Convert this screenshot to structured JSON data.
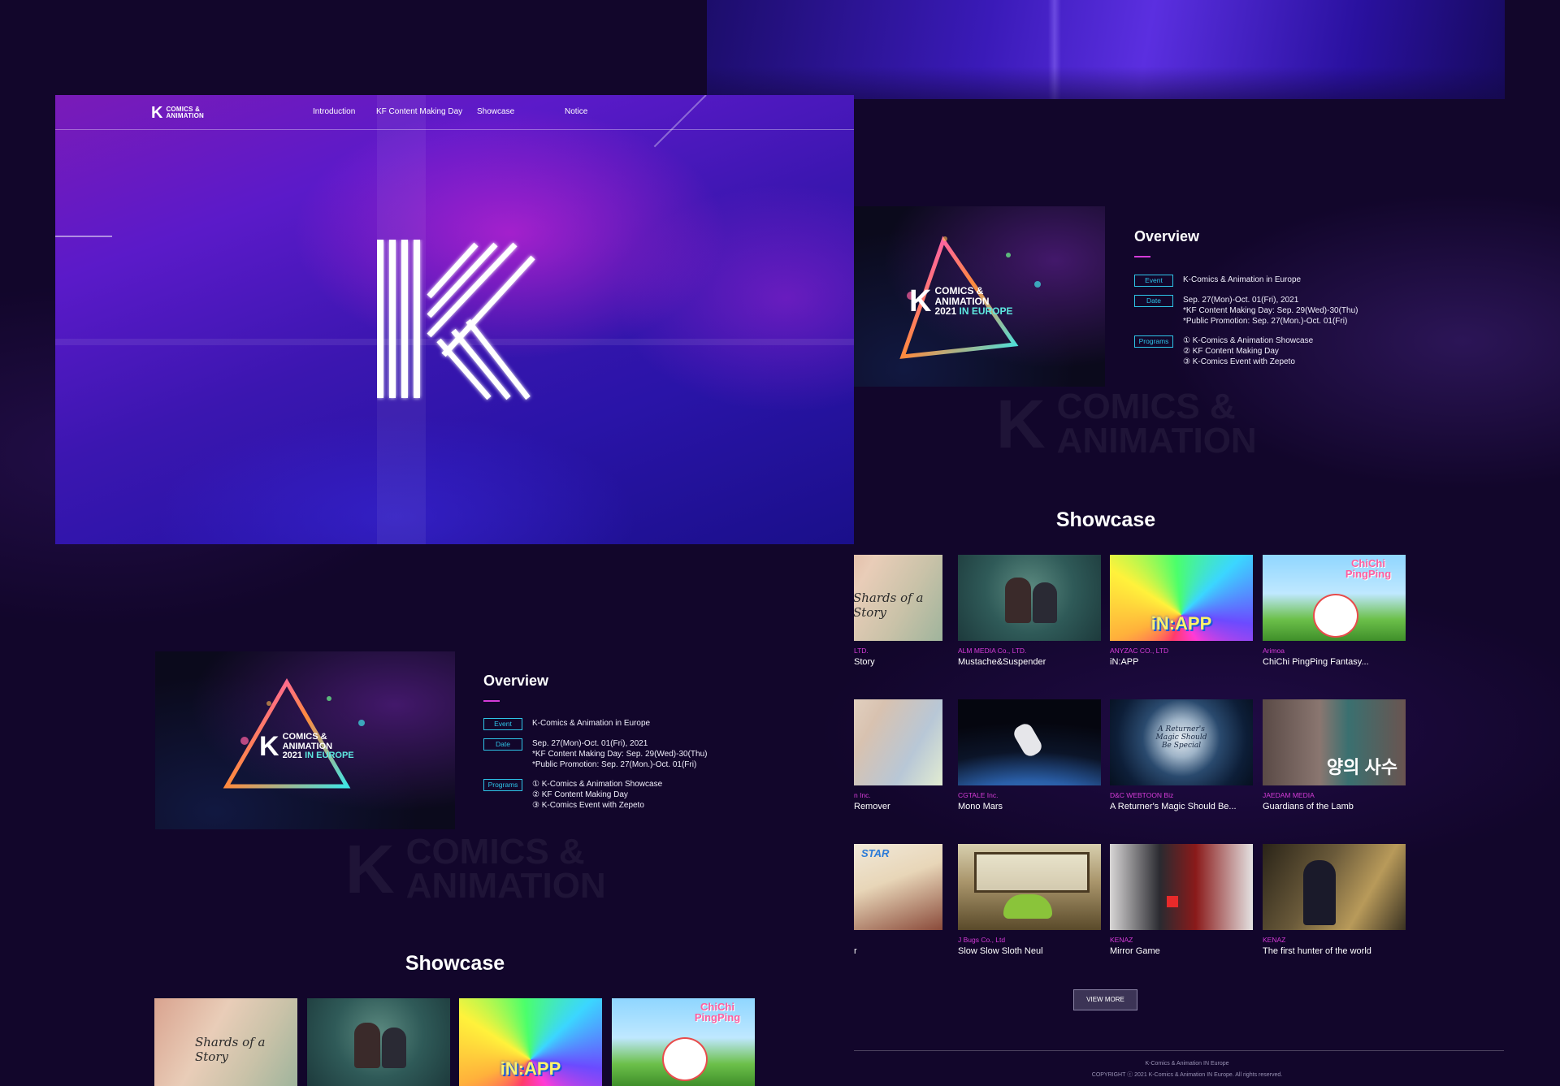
{
  "brand": {
    "k": "K",
    "line1": "COMICS &",
    "line2": "ANIMATION"
  },
  "nav": [
    "Introduction",
    "KF Content Making Day",
    "Showcase",
    "Notice"
  ],
  "hero_letter": "K",
  "event_logo": {
    "k": "K",
    "line1": "COMICS &",
    "line2": "ANIMATION",
    "line3a": "2021",
    "line3b": "IN EUROPE"
  },
  "overview": {
    "title": "Overview",
    "rows": [
      {
        "tag": "Event",
        "lines": [
          "K-Comics & Animation in Europe"
        ]
      },
      {
        "tag": "Date",
        "lines": [
          "Sep. 27(Mon)-Oct. 01(Fri), 2021",
          "*KF Content Making Day: Sep. 29(Wed)-30(Thu)",
          "*Public Promotion: Sep. 27(Mon.)-Oct. 01(Fri)"
        ]
      },
      {
        "tag": "Programs",
        "lines": [
          "① K-Comics & Animation Showcase",
          "② KF Content Making Day",
          "③ K-Comics Event with Zepeto"
        ]
      }
    ]
  },
  "watermark": {
    "k": "K",
    "line1": "COMICS &",
    "line2": "ANIMATION"
  },
  "showcase": {
    "title": "Showcase",
    "cards": [
      {
        "studio": "LTD.",
        "title": "Story",
        "thumb_text": "Shards of a Story",
        "thumb": "shards"
      },
      {
        "studio": "ALM MEDIA Co., LTD.",
        "title": "Mustache&Suspender",
        "thumb": "mustache"
      },
      {
        "studio": "ANYZAC CO., LTD",
        "title": "iN:APP",
        "thumb_text": "iN:APP",
        "thumb": "inapp"
      },
      {
        "studio": "Arimoa",
        "title": "ChiChi PingPing Fantasy...",
        "thumb_text": "ChiChi PingPing",
        "thumb": "chichi"
      },
      {
        "studio": "n Inc.",
        "title": "Remover",
        "thumb": "remover"
      },
      {
        "studio": "CGTALE Inc.",
        "title": "Mono Mars",
        "thumb": "monomars"
      },
      {
        "studio": "D&C WEBTOON Biz",
        "title": "A Returner's Magic Should Be...",
        "thumb_text": "A Returner's Magic Should Be Special",
        "thumb": "returner"
      },
      {
        "studio": "JAEDAM MEDIA",
        "title": "Guardians of the Lamb",
        "thumb_text": "양의 사수",
        "thumb": "guardians"
      },
      {
        "studio": "",
        "title": "r",
        "thumb_text": "STAR",
        "thumb": "star"
      },
      {
        "studio": "J Bugs Co., Ltd",
        "title": "Slow Slow Sloth Neul",
        "thumb": "sloth"
      },
      {
        "studio": "KENAZ",
        "title": "Mirror Game",
        "thumb": "mirror"
      },
      {
        "studio": "KENAZ",
        "title": "The first hunter of the world",
        "thumb": "hunter"
      }
    ]
  },
  "view_more": "VIEW MORE",
  "footer": {
    "line1": "K-Comics & Animation IN Europe",
    "line2": "COPYRIGHT ⓒ 2021 K-Comics & Animation IN Europe. All rights reserved."
  }
}
